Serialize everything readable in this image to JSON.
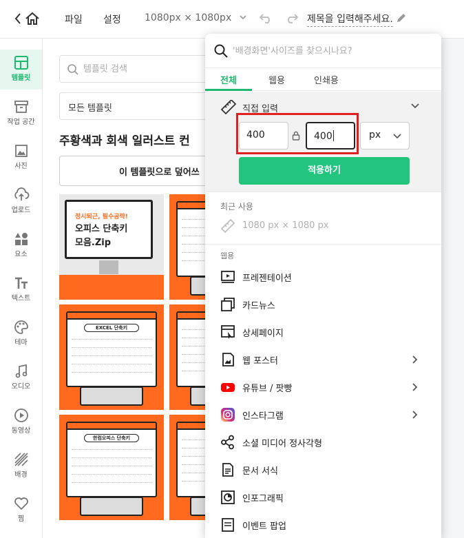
{
  "topbar": {
    "menu_file": "파일",
    "menu_settings": "설정",
    "canvas_size": "1080px × 1080px",
    "doc_title": "제목을 입력해주세요."
  },
  "rail": {
    "items": [
      {
        "label": "템플릿"
      },
      {
        "label": "작업 공간"
      },
      {
        "label": "사진"
      },
      {
        "label": "업로드"
      },
      {
        "label": "요소"
      },
      {
        "label": "텍스트"
      },
      {
        "label": "테마"
      },
      {
        "label": "오디오"
      },
      {
        "label": "동영상"
      },
      {
        "label": "배경"
      },
      {
        "label": "찜"
      }
    ]
  },
  "panel": {
    "search_placeholder": "템플릿 검색",
    "select_value": "모든 템플릿",
    "template_title": "주황색과 회색 일러스트 컨",
    "cover_button": "이 템플릿으로 덮어쓰",
    "hero": {
      "line1": "정시퇴근, 필수공략!",
      "line2": "오피스 단축키",
      "line3": "모음.Zip"
    },
    "thumb_excel": "EXCEL 단축키",
    "thumb_hancom": "한컴오피스 단축키"
  },
  "dropdown": {
    "search_placeholder": "'배경화면'사이즈를 찾으시나요?",
    "tabs": {
      "all": "전체",
      "web": "웹용",
      "print": "인쇄용"
    },
    "custom": {
      "label": "직접 입력",
      "width": "400",
      "height": "400",
      "unit": "px",
      "apply": "적용하기"
    },
    "recent_header": "최근 사용",
    "recent_item": "1080 px × 1080 px",
    "category_header": "웹용",
    "categories": [
      {
        "label": "프레젠테이션"
      },
      {
        "label": "카드뉴스"
      },
      {
        "label": "상세페이지"
      },
      {
        "label": "웹 포스터"
      },
      {
        "label": "유튜브 / 팟빵"
      },
      {
        "label": "인스타그램"
      },
      {
        "label": "소셜 미디어 정사각형"
      },
      {
        "label": "문서 서식"
      },
      {
        "label": "인포그래픽"
      },
      {
        "label": "이벤트 팝업"
      }
    ]
  },
  "colors": {
    "accent": "#1fb86f",
    "apply_button": "#22c47e",
    "highlight": "#e02020",
    "thumb_orange": "#ff6a1f"
  }
}
